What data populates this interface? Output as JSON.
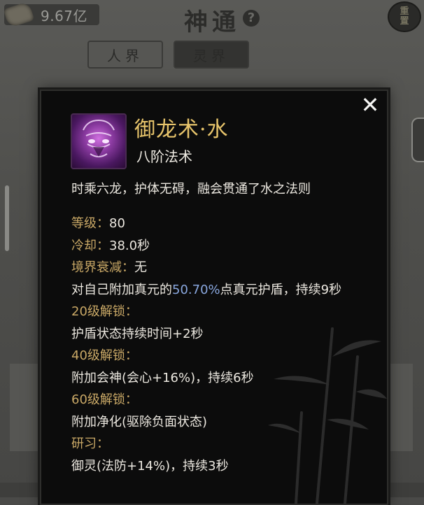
{
  "currency": {
    "value": "9.67亿",
    "icon": "scroll-currency-icon"
  },
  "header": {
    "title": "神通",
    "help": "?",
    "reset_line1": "重",
    "reset_line2": "置"
  },
  "tabs": [
    {
      "label": "人界",
      "active": false
    },
    {
      "label": "灵界",
      "active": true
    }
  ],
  "tooltip": {
    "close": "✕",
    "skill_name": "御龙术·水",
    "tier": "八阶法术",
    "description": "时乘六龙，护体无碍，融会贯通了水之法则",
    "level_label": "等级：",
    "level_value": "80",
    "cooldown_label": "冷却：",
    "cooldown_value": "38.0秒",
    "decay_label": "境界衰减：",
    "decay_value": "无",
    "effect_prefix": "对自己附加真元的",
    "effect_percent": "50.70%",
    "effect_suffix": "点真元护盾，持续9秒",
    "unlock20_label": "20级解锁：",
    "unlock20_text": "护盾状态持续时间+2秒",
    "unlock40_label": "40级解锁：",
    "unlock40_text": "附加会神(会心+16%)，持续6秒",
    "unlock60_label": "60级解锁：",
    "unlock60_text": "附加净化(驱除负面状态)",
    "study_label": "研习：",
    "study_text": "御灵(法防+14%)，持续3秒"
  },
  "colors": {
    "label_gold": "#c9a866",
    "name_gold": "#e7c46b",
    "highlight_blue": "#8aa8e0",
    "panel_bg": "#0c0c0c"
  }
}
